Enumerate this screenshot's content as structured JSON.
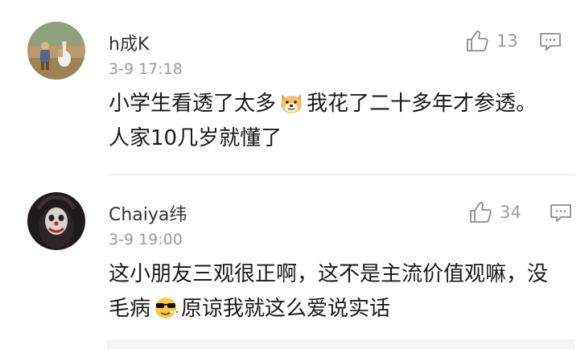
{
  "comments": [
    {
      "username": "h成K",
      "time": "3-9 17:18",
      "likes": "13",
      "text_before_emoji": "小学生看透了太多",
      "emoji": "doge-emoji",
      "text_after_emoji": "我花了二十多年才参透。 人家10几岁就懂了"
    },
    {
      "username": "Chaiya纬",
      "time": "3-9 19:00",
      "likes": "34",
      "text_before_emoji": "这小朋友三观很正啊，这不是主流价值观嘛，没毛病",
      "emoji": "cool-sunglasses-emoji",
      "text_after_emoji": "原谅我就这么爱说实话"
    }
  ],
  "colors": {
    "meta_gray": "#9b9b9b",
    "divider": "#e5e5e5",
    "text": "#1a1a1a"
  }
}
